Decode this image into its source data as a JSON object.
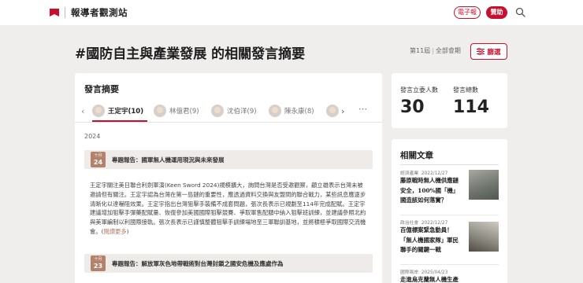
{
  "header": {
    "logo_text": "報導者觀測站",
    "epaper_label": "電子報",
    "donate_label": "贊助"
  },
  "page": {
    "title": "#國防自主與產業發展 的相關發言摘要",
    "session": "第11屆",
    "period": "全部會期",
    "filter_label": "篩選"
  },
  "summary": {
    "heading": "發言摘要",
    "legislators": [
      {
        "name": "王定宇(10)"
      },
      {
        "name": "林億君(9)"
      },
      {
        "name": "沈伯洋(9)"
      },
      {
        "name": "陳永康(8)"
      }
    ],
    "year": "2024",
    "reports": [
      {
        "month": "十月",
        "day": "24",
        "title": "專題報告：國軍無人機運用現況與未來發展",
        "body": "王定宇關注美日聯合利劍軍演(Keen Sword 2024)規模擴大，詢問台灣是否受邀觀察，顧立雄表示台灣未被邀請但有關注。王定宇認為台灣在第一島鏈的重要性，應透過資料交換與友盟間的聯合戰力，某些訊息應逐步清晰化以達嚇阻效果。王定宇指出台灣狙擊手裝備不成套問題，張次長表示已規劃至114年完成配賦。王定宇建議增加狙擊手彈藥配賦量、恢復參加美國國際狙擊競賽、爭取軍售配額中納入狙擊班訓練，並建議參照北約與美軍編制以利國際接軌。張次長表示已謹慎整體狙擊手訓練場地至三軍聯訓基地，並將積極爭取國際交流機會。(",
        "read_more": "閱讀更多",
        "body_end": ")"
      },
      {
        "month": "十月",
        "day": "23",
        "title": "專題報告：解放軍灰色地帶戰術對台灣封鎖之國安危機及應處作為"
      }
    ]
  },
  "stats": {
    "members_label": "發言立委人數",
    "members_value": "30",
    "total_label": "發言總數",
    "total_value": "114"
  },
  "related": {
    "heading": "相關文章",
    "articles": [
      {
        "category": "經濟產業",
        "date": "2022/12/27",
        "title": "藤原戰時無人機供應鏈安全，100%國「機」國造該如何落實？"
      },
      {
        "category": "政治社會",
        "date": "2022/12/27",
        "title": "百億標案緊急動員！「無人機國家隊」軍民聯手的關鍵一戰"
      },
      {
        "category": "國際兩岸",
        "date": "2025/04/23",
        "title": "走進烏克蘭無人機生產"
      }
    ]
  },
  "colors": {
    "brand_red": "#c8102e",
    "badge_brown": "#b3826a",
    "background": "#f0eeed"
  }
}
